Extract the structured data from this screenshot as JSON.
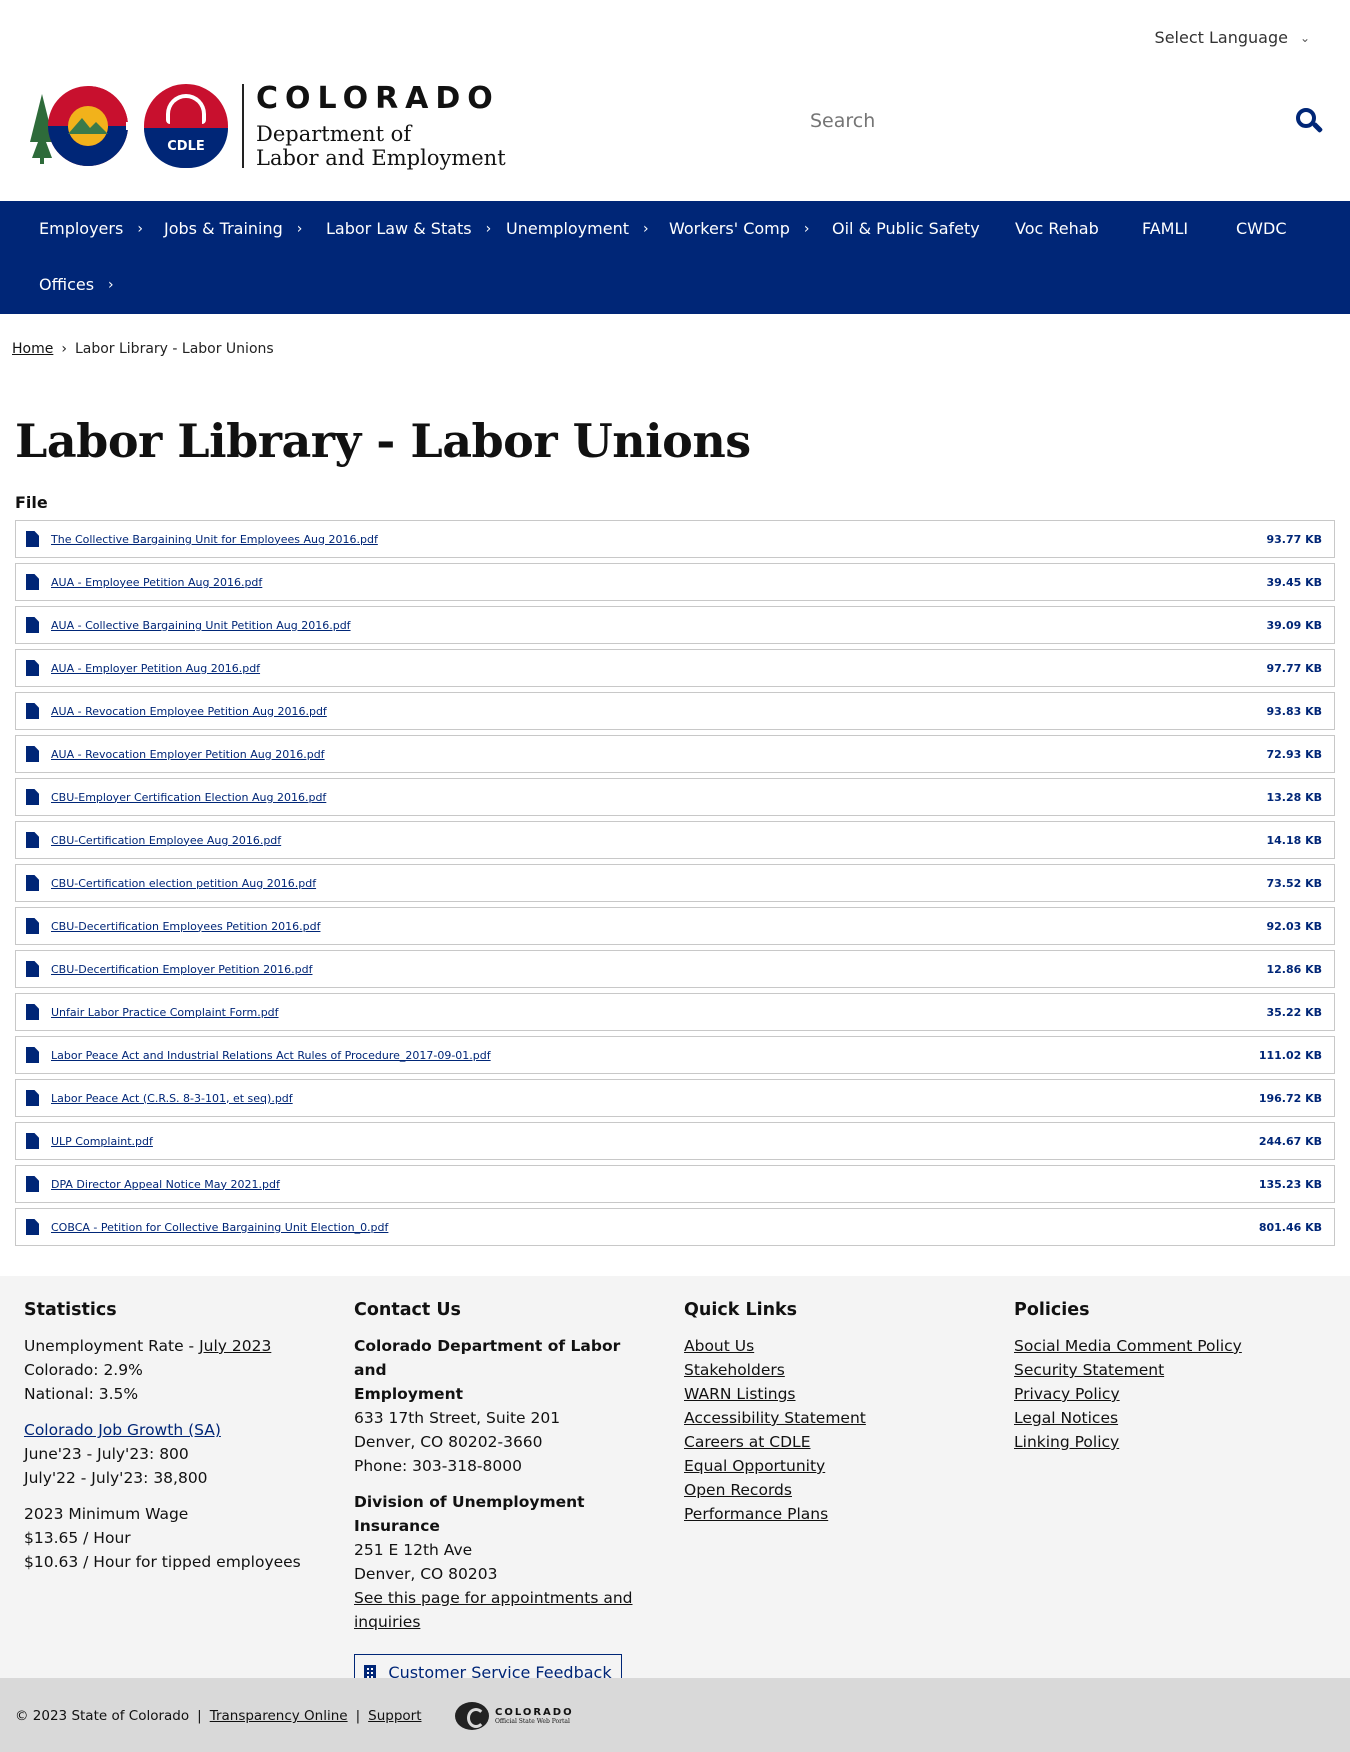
{
  "header": {
    "language_select": "Select Language",
    "logo_colorado": "COLORADO",
    "logo_dept_line1": "Department of",
    "logo_dept_line2": "Labor and Employment",
    "logo_cdle_badge": "CDLE",
    "search_placeholder": "Search"
  },
  "nav": {
    "items": [
      {
        "label": "Employers",
        "has_submenu": true
      },
      {
        "label": "Jobs & Training",
        "has_submenu": true
      },
      {
        "label": "Labor Law & Stats",
        "has_submenu": true
      },
      {
        "label": "Unemployment",
        "has_submenu": true
      },
      {
        "label": "Workers' Comp",
        "has_submenu": true
      },
      {
        "label": "Oil & Public Safety",
        "has_submenu": false
      },
      {
        "label": "Voc Rehab",
        "has_submenu": false
      },
      {
        "label": "FAMLI",
        "has_submenu": false
      },
      {
        "label": "CWDC",
        "has_submenu": false
      },
      {
        "label": "Offices",
        "has_submenu": true
      }
    ]
  },
  "breadcrumb": {
    "home": "Home",
    "separator": "›",
    "current": "Labor Library - Labor Unions"
  },
  "page": {
    "title": "Labor Library - Labor Unions",
    "file_column_label": "File"
  },
  "files": [
    {
      "name": "The Collective Bargaining Unit for Employees Aug 2016.pdf",
      "size": "93.77 KB"
    },
    {
      "name": "AUA - Employee Petition Aug 2016.pdf",
      "size": "39.45 KB"
    },
    {
      "name": "AUA - Collective Bargaining Unit Petition Aug 2016.pdf",
      "size": "39.09 KB"
    },
    {
      "name": "AUA - Employer Petition Aug 2016.pdf",
      "size": "97.77 KB"
    },
    {
      "name": "AUA - Revocation Employee Petition Aug 2016.pdf",
      "size": "93.83 KB"
    },
    {
      "name": "AUA - Revocation Employer Petition Aug 2016.pdf",
      "size": "72.93 KB"
    },
    {
      "name": "CBU-Employer Certification Election Aug 2016.pdf",
      "size": "13.28 KB"
    },
    {
      "name": "CBU-Certification Employee Aug 2016.pdf",
      "size": "14.18 KB"
    },
    {
      "name": "CBU-Certification election petition Aug 2016.pdf",
      "size": "73.52 KB"
    },
    {
      "name": "CBU-Decertification Employees Petition 2016.pdf",
      "size": "92.03 KB"
    },
    {
      "name": "CBU-Decertification Employer Petition 2016.pdf",
      "size": "12.86 KB"
    },
    {
      "name": "Unfair Labor Practice Complaint Form.pdf",
      "size": "35.22 KB"
    },
    {
      "name": "Labor Peace Act and Industrial Relations Act Rules of Procedure_2017-09-01.pdf",
      "size": "111.02 KB"
    },
    {
      "name": "Labor Peace Act (C.R.S. 8-3-101, et seq).pdf",
      "size": "196.72 KB"
    },
    {
      "name": "ULP Complaint.pdf",
      "size": "244.67 KB"
    },
    {
      "name": "DPA Director Appeal Notice May 2021.pdf",
      "size": "135.23 KB"
    },
    {
      "name": "COBCA - Petition for Collective Bargaining Unit Election_0.pdf",
      "size": "801.46 KB"
    }
  ],
  "footer": {
    "statistics": {
      "heading": "Statistics",
      "unemployment_prefix": "Unemployment Rate - ",
      "unemployment_link": "July 2023",
      "colorado": "Colorado: 2.9%",
      "national": "National: 3.5%",
      "job_growth_link": "Colorado Job Growth (SA)",
      "job_growth_1": "June'23 - July'23: 800",
      "job_growth_2": "July'22 - July'23: 38,800",
      "min_wage_heading": "2023 Minimum Wage",
      "min_wage_1": "$13.65 / Hour",
      "min_wage_2": "$10.63 / Hour for tipped employees"
    },
    "contact": {
      "heading": "Contact Us",
      "org_line1": "Colorado Department of Labor and",
      "org_line2": "Employment",
      "address1": "633 17th Street, Suite 201",
      "address2": "Denver, CO  80202-3660",
      "phone": "Phone: 303-318-8000",
      "division": "Division of Unemployment Insurance",
      "div_address1": "251 E 12th Ave",
      "div_address2": "Denver, CO  80203",
      "appointments_link_line1": "See this page for appointments and",
      "appointments_link_line2": "inquiries",
      "feedback_button": "Customer Service Feedback"
    },
    "quick_links": {
      "heading": "Quick Links",
      "items": [
        "About Us",
        "Stakeholders",
        "WARN Listings",
        "Accessibility Statement",
        "Careers at CDLE",
        "Equal Opportunity",
        "Open Records",
        "Performance Plans"
      ]
    },
    "policies": {
      "heading": "Policies",
      "items": [
        "Social Media Comment Policy",
        "Security Statement",
        "Privacy Policy",
        "Legal Notices",
        "Linking Policy"
      ]
    }
  },
  "bottom_bar": {
    "copyright": "© 2023 State of Colorado",
    "separator": "|",
    "transparency": "Transparency Online",
    "support": "Support",
    "portal_title": "COLORADO",
    "portal_subtitle": "Official State Web Portal"
  },
  "colors": {
    "brand_navy": "#002677",
    "brand_red": "#c8102e",
    "footer_bg": "#f4f4f4",
    "bottom_bar_bg": "#d9d9d9"
  }
}
